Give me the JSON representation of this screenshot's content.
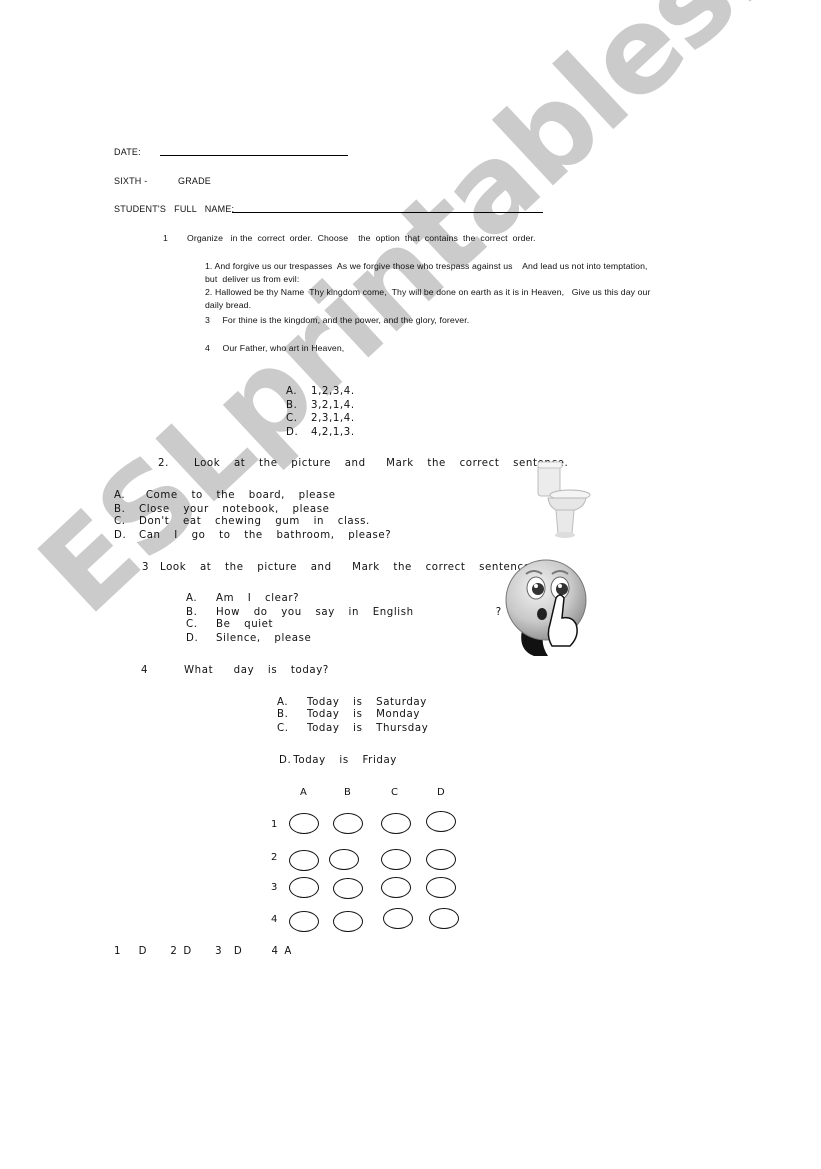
{
  "header": {
    "date_label": "DATE:",
    "grade_prefix": "SIXTH -",
    "grade_label": "GRADE",
    "name_label": "STUDENT'S   FULL   NAME:"
  },
  "q1": {
    "number": "1",
    "prompt": "Organize   in the  correct  order.  Choose    the  option  that  contains  the  correct  order.",
    "items": [
      "1. And forgive us our trespasses  As we forgive those who trespass against us    And lead us not into temptation,",
      "but  deliver us from evil:",
      "2. Hallowed be thy Name  Thy kingdom come,  Thy will be done on earth as it is in Heaven,   Give us this day our",
      "daily bread.",
      "3     For thine is the kingdom, and the power, and the glory, forever.",
      "4     Our Father, who art in Heaven,"
    ],
    "options": [
      {
        "letter": "A.",
        "text": "1,2,3,4."
      },
      {
        "letter": "B.",
        "text": "3,2,1,4."
      },
      {
        "letter": "C.",
        "text": "2,3,1,4."
      },
      {
        "letter": "D.",
        "text": "4,2,1,3."
      }
    ]
  },
  "q2": {
    "number": "2.",
    "prompt": "Look  at  the  picture  and   Mark  the  correct  sentence.",
    "picture": "toilet-image",
    "options": [
      {
        "letter": "A.",
        "text": " Come  to  the  board,  please"
      },
      {
        "letter": "B.",
        "text": "Close  your  notebook,  please"
      },
      {
        "letter": "C.",
        "text": "Don't  eat  chewing  gum  in  class."
      },
      {
        "letter": "D.",
        "text": "Can  I  go  to  the  bathroom,  please?"
      }
    ]
  },
  "q3": {
    "number": "3",
    "prompt": "Look  at  the  picture  and   Mark  the  correct  sentence",
    "picture": "shush-emoji-image",
    "options": [
      {
        "letter": "A.",
        "text": "Am  I  clear?"
      },
      {
        "letter": "B.",
        "text": "How  do  you  say  in  English            ?"
      },
      {
        "letter": "C.",
        "text": "Be  quiet"
      },
      {
        "letter": "D.",
        "text": "Silence,  please"
      }
    ]
  },
  "q4": {
    "number": "4",
    "prompt": "What   day  is  today?",
    "options": [
      {
        "letter": "A.",
        "text": "Today  is  Saturday"
      },
      {
        "letter": "B.",
        "text": "Today  is  Monday"
      },
      {
        "letter": "C.",
        "text": "Today  is  Thursday"
      },
      {
        "letter": "D.",
        "text": "Today  is  Friday"
      }
    ]
  },
  "answer_grid": {
    "columns": [
      "A",
      "B",
      "C",
      "D"
    ],
    "rows": [
      "1",
      "2",
      "3",
      "4"
    ]
  },
  "answer_key": "1   D    2 D    3  D     4 A",
  "watermark": "ESLprintables.com"
}
